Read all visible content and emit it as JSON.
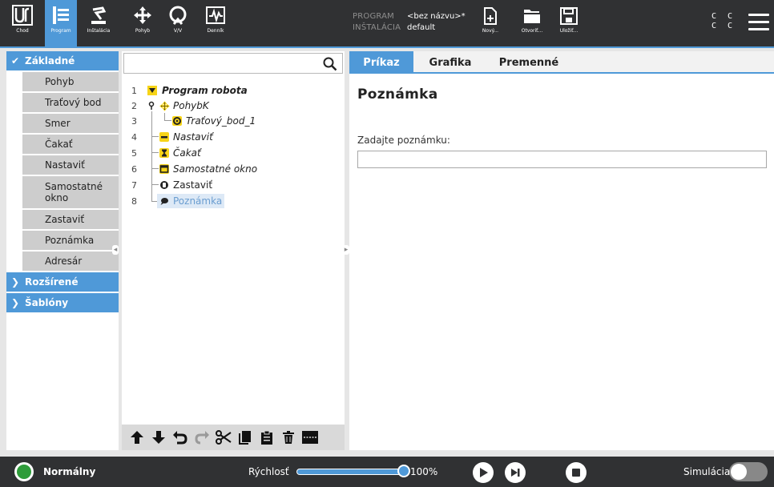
{
  "header": {
    "logo_text": "UR",
    "nav": [
      {
        "label": "Chod",
        "icon": "ur-logo-icon"
      },
      {
        "label": "Program",
        "icon": "program-icon",
        "active": true
      },
      {
        "label": "Inštalácia",
        "icon": "installation-icon"
      },
      {
        "label": "Pohyb",
        "icon": "move-icon"
      },
      {
        "label": "V/V",
        "icon": "io-icon"
      },
      {
        "label": "Denník",
        "icon": "log-icon"
      }
    ],
    "program_key": "PROGRAM",
    "program_value": "<bez názvu>*",
    "installation_key": "INŠTALÁCIA",
    "installation_value": "default",
    "file_buttons": [
      {
        "label": "Nový...",
        "icon": "new-file-icon"
      },
      {
        "label": "Otvoriť...",
        "icon": "open-folder-icon"
      },
      {
        "label": "Uložiť...",
        "icon": "save-icon"
      }
    ],
    "cc_text": "C C\nC C",
    "menu_icon": "hamburger-menu-icon"
  },
  "left_panel": {
    "categories": [
      {
        "label": "Základné",
        "expanded": true
      },
      {
        "label": "Rozšírené",
        "expanded": false
      },
      {
        "label": "Šablóny",
        "expanded": false
      }
    ],
    "commands": [
      "Pohyb",
      "Traťový bod",
      "Smer",
      "Čakať",
      "Nastaviť",
      "Samostatné okno",
      "Zastaviť",
      "Poznámka",
      "Adresár"
    ]
  },
  "tree": {
    "search_placeholder": "",
    "rows": [
      {
        "num": "1",
        "text": "Program robota",
        "icon": "collapse-arrow-icon"
      },
      {
        "num": "2",
        "text": "PohybK",
        "icon": "move-icon"
      },
      {
        "num": "3",
        "text": "Traťový_bod_1",
        "icon": "waypoint-icon"
      },
      {
        "num": "4",
        "text": "Nastaviť",
        "icon": "set-icon"
      },
      {
        "num": "5",
        "text": "Čakať",
        "icon": "hourglass-icon"
      },
      {
        "num": "6",
        "text": "Samostatné okno",
        "icon": "popup-icon"
      },
      {
        "num": "7",
        "text": "Zastaviť",
        "icon": "stop-hand-icon"
      },
      {
        "num": "8",
        "text": "Poznámka",
        "icon": "comment-icon",
        "selected": true
      }
    ],
    "toolbar": [
      "move-up-icon",
      "move-down-icon",
      "undo-icon",
      "redo-icon",
      "cut-icon",
      "copy-icon",
      "paste-icon",
      "delete-icon",
      "suppress-icon"
    ]
  },
  "right_panel": {
    "tabs": [
      "Príkaz",
      "Grafika",
      "Premenné"
    ],
    "active_tab": "Príkaz",
    "title": "Poznámka",
    "note_label": "Zadajte poznámku:",
    "note_value": ""
  },
  "footer": {
    "status": "Normálny",
    "status_color": "#2e9c3a",
    "speed_label": "Rýchlosť",
    "speed_value": "100%",
    "speed_fraction": 1.0,
    "sim_label": "Simulácia",
    "sim_on": false
  },
  "colors": {
    "accent": "#4f99d8",
    "header_bg": "#303133",
    "command_bg": "#cdcdcd"
  }
}
